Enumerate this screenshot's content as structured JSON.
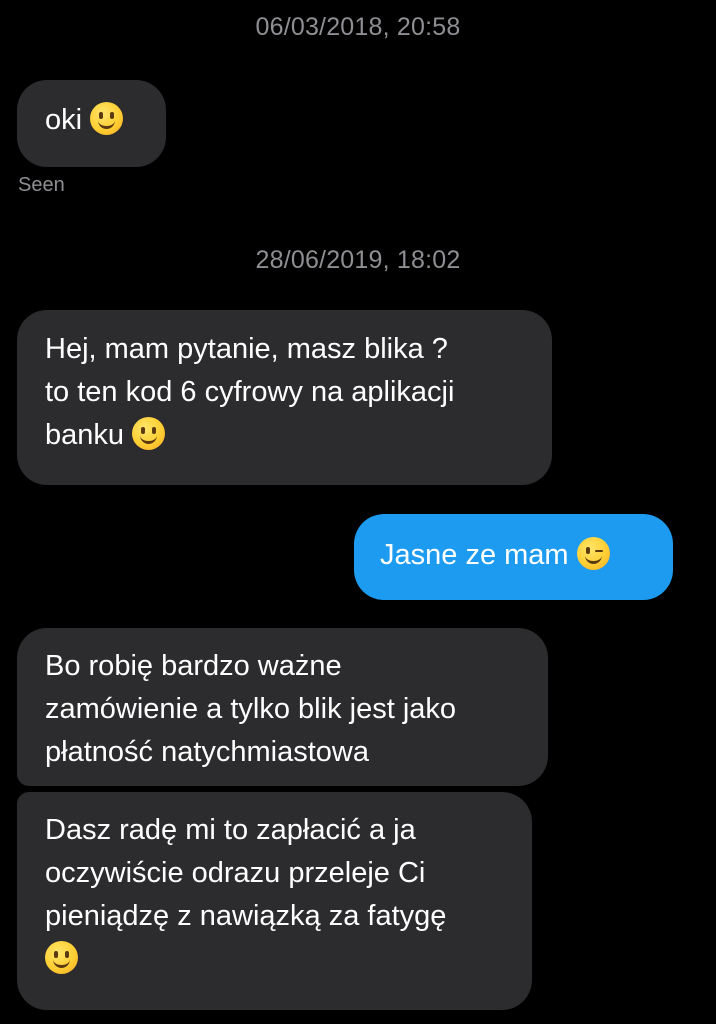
{
  "conversation": {
    "timestamp_1": "06/03/2018, 20:58",
    "msg_oki": "oki",
    "seen_label": "Seen",
    "timestamp_2": "28/06/2019, 18:02",
    "msg_hej": {
      "line1": "Hej, mam pytanie, masz blika ?",
      "line2": "to ten kod 6 cyfrowy na aplikacji",
      "line3": "banku"
    },
    "msg_jasne": "Jasne ze mam",
    "msg_bo": {
      "line1": "Bo robię bardzo ważne",
      "line2": "zamówienie a tylko blik jest jako",
      "line3": "płatność natychmiastowa"
    },
    "msg_dasz": {
      "line1": "Dasz radę mi to zapłacić a ja",
      "line2": "oczywiście odrazu przeleje Ci",
      "line3": "pieniądzę z nawiązką za fatygę"
    }
  },
  "icons": {
    "smile": "slightly-smiling-face-icon",
    "wink": "winking-face-icon"
  },
  "colors": {
    "background": "#000000",
    "incoming_bubble": "#2c2c2e",
    "outgoing_bubble": "#1c9bf0",
    "meta_text": "#8e8e93"
  }
}
